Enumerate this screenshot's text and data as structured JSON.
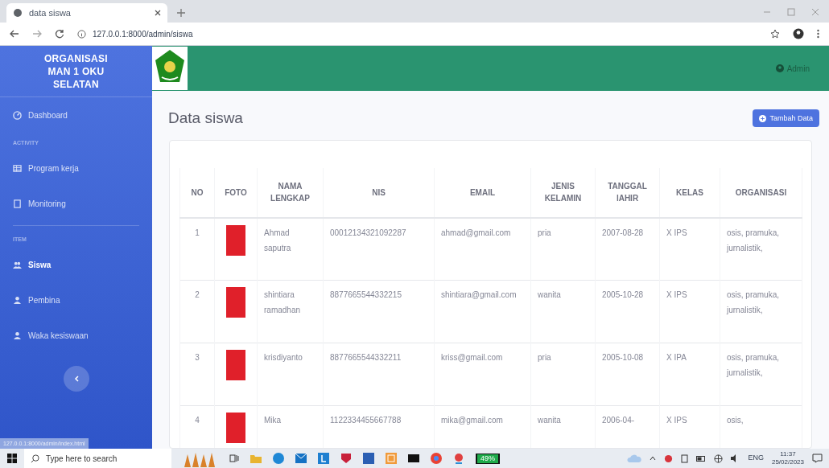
{
  "browser": {
    "tab_title": "data siswa",
    "url": "127.0.0.1:8000/admin/siswa",
    "status_url": "127.0.0.1:8000/admin/index.html"
  },
  "sidebar": {
    "brand": "ORGANISASI MAN 1 OKU SELATAN",
    "items": [
      {
        "kind": "link",
        "label": "Dashboard",
        "selected": false
      },
      {
        "kind": "heading",
        "label": "ACTIVITY"
      },
      {
        "kind": "link",
        "label": "Program kerja",
        "selected": false
      },
      {
        "kind": "link",
        "label": "Monitoring",
        "selected": false
      },
      {
        "kind": "divider"
      },
      {
        "kind": "heading",
        "label": "ITEM"
      },
      {
        "kind": "link",
        "label": "Siswa",
        "selected": true
      },
      {
        "kind": "link",
        "label": "Pembina",
        "selected": false
      },
      {
        "kind": "link",
        "label": "Waka kesiswaan",
        "selected": false
      }
    ]
  },
  "header": {
    "user": "Admin"
  },
  "page": {
    "title": "Data siswa",
    "add_button": "Tambah Data"
  },
  "table": {
    "columns": [
      "NO",
      "FOTO",
      "NAMA LENGKAP",
      "NIS",
      "EMAIL",
      "JENIS KELAMIN",
      "TANGGAL lAHIR",
      "KELAS",
      "ORGANISASI"
    ],
    "rows": [
      {
        "no": "1",
        "name": "Ahmad saputra",
        "nis": "00012134321092287",
        "email": "ahmad@gmail.com",
        "gender": "pria",
        "date": "2007-08-28",
        "kelas": "X IPS",
        "org": "osis, pramuka, jurnalistik,"
      },
      {
        "no": "2",
        "name": "shintiara ramadhan",
        "nis": "8877665544332215",
        "email": "shintiara@gmail.com",
        "gender": "wanita",
        "date": "2005-10-28",
        "kelas": "X IPS",
        "org": "osis, pramuka, jurnalistik,"
      },
      {
        "no": "3",
        "name": "krisdiyanto",
        "nis": "8877665544332211",
        "email": "kriss@gmail.com",
        "gender": "pria",
        "date": "2005-10-08",
        "kelas": "X IPA",
        "org": "osis, pramuka, jurnalistik,"
      },
      {
        "no": "4",
        "name": "Mika",
        "nis": "1122334455667788",
        "email": "mika@gmail.com",
        "gender": "wanita",
        "date": "2006-04-",
        "kelas": "X IPS",
        "org": "osis,"
      }
    ]
  },
  "taskbar": {
    "search_placeholder": "Type here to search",
    "battery": "49%",
    "language": "ENG",
    "time": "11:37",
    "date": "25/02/2023"
  }
}
